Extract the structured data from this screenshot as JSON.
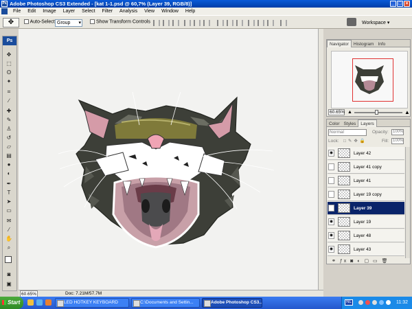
{
  "window": {
    "title": "Adobe Photoshop CS3 Extended - [kat 1-1.psd @ 60,7% (Layer 39, RGB/8)]",
    "app_icon": "Ps"
  },
  "menu": [
    "File",
    "Edit",
    "Image",
    "Layer",
    "Select",
    "Filter",
    "Analysis",
    "View",
    "Window",
    "Help"
  ],
  "options": {
    "auto_select_label": "Auto-Select:",
    "auto_select_value": "Group",
    "show_transform_label": "Show Transform Controls",
    "workspace_label": "Workspace ▾"
  },
  "toolbox": {
    "badge": "Ps"
  },
  "status": {
    "zoom": "60.65%",
    "doc": "Doc: 7.21M/57.7M"
  },
  "navigator": {
    "tabs": [
      "Navigator",
      "Histogram",
      "Info"
    ],
    "zoom": "60.65%"
  },
  "layers_panel": {
    "tabs": [
      "Color",
      "Styles",
      "Layers"
    ],
    "blend_mode": "Normal",
    "opacity_label": "Opacity:",
    "opacity": "100%",
    "lock_label": "Lock:",
    "fill_label": "Fill:",
    "fill": "100%",
    "layers": [
      {
        "name": "Layer 42",
        "visible": true,
        "selected": false
      },
      {
        "name": "Layer 41 copy",
        "visible": false,
        "selected": false
      },
      {
        "name": "Layer 41",
        "visible": false,
        "selected": false
      },
      {
        "name": "Layer 19 copy",
        "visible": false,
        "selected": false
      },
      {
        "name": "Layer 39",
        "visible": false,
        "selected": true
      },
      {
        "name": "Layer 19",
        "visible": true,
        "selected": false
      },
      {
        "name": "Layer 48",
        "visible": true,
        "selected": false
      },
      {
        "name": "Layer 43",
        "visible": true,
        "selected": false
      }
    ]
  },
  "taskbar": {
    "start": "Start",
    "tasks": [
      "LED HOTKEY KEYBOARD",
      "C:\\Documents and Settin...",
      "Adobe Photoshop CS3..."
    ],
    "language": "NL",
    "clock": "11:32"
  },
  "colors": {
    "selected_layer": "#0a246a",
    "title_bar": "#0a5ad8",
    "nav_viewbox": "#e03030"
  }
}
